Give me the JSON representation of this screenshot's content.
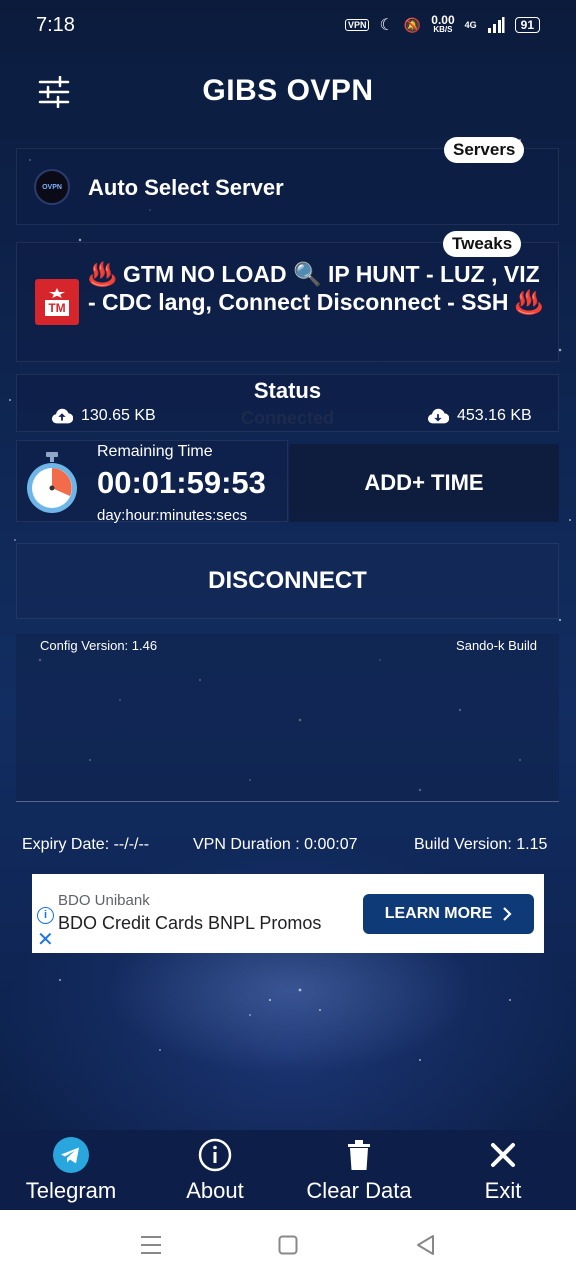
{
  "status_bar": {
    "time": "7:18",
    "net_speed_value": "0.00",
    "net_speed_unit": "KB/S",
    "network": "4G",
    "battery": "91",
    "vpn_label": "VPN"
  },
  "header": {
    "title": "GIBS OVPN"
  },
  "server": {
    "tag": "Servers",
    "name": "Auto Select Server"
  },
  "tweak": {
    "tag": "Tweaks",
    "text": "♨️ GTM NO LOAD 🔍 IP HUNT - LUZ , VIZ - CDC lang, Connect Disconnect - SSH ♨️",
    "logo_label": "TM"
  },
  "status": {
    "title": "Status",
    "state": "Connected",
    "upload": "130.65 KB",
    "download": "453.16 KB"
  },
  "timer": {
    "label": "Remaining Time",
    "value": "00:01:59:53",
    "units": "day:hour:minutes:secs",
    "add_time_label": "ADD+ TIME"
  },
  "actions": {
    "disconnect_label": "DISCONNECT"
  },
  "log": {
    "config_version": "Config Version: 1.46",
    "build_by": "Sando-k Build"
  },
  "info_row": {
    "expiry": "Expiry Date: --/-/--",
    "duration": "VPN Duration : 0:00:07",
    "build": "Build Version: 1.15"
  },
  "ad": {
    "advertiser": "BDO Unibank",
    "headline": "BDO Credit Cards BNPL Promos",
    "cta": "LEARN MORE"
  },
  "bottom_nav": {
    "items": [
      {
        "label": "Telegram",
        "icon": "telegram-icon"
      },
      {
        "label": "About",
        "icon": "info-icon"
      },
      {
        "label": "Clear Data",
        "icon": "trash-icon"
      },
      {
        "label": "Exit",
        "icon": "close-icon"
      }
    ]
  },
  "colors": {
    "accent": "#0f3a78",
    "telegram": "#2aa6df",
    "background": "#0e2550"
  }
}
